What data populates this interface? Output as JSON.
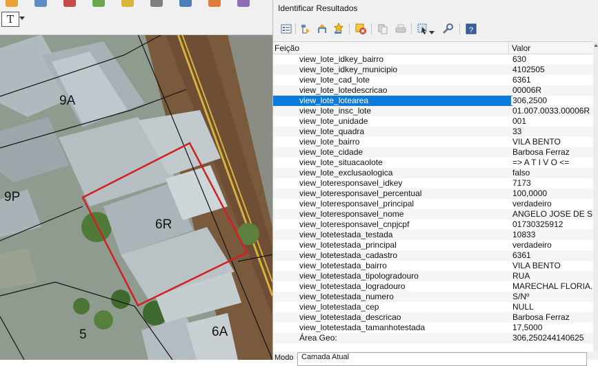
{
  "panel": {
    "title": "Identificar Resultados",
    "columns": {
      "feature": "Feição",
      "value": "Valor"
    },
    "rows": [
      {
        "key": "view_lote_idkey_bairro",
        "value": "630"
      },
      {
        "key": "view_lote_idkey_municipio",
        "value": "4102505"
      },
      {
        "key": "view_lote_cad_lote",
        "value": "6361"
      },
      {
        "key": "view_lote_lotedescricao",
        "value": "00006R"
      },
      {
        "key": "view_lote_lotearea",
        "value": "306,2500"
      },
      {
        "key": "view_lote_insc_lote",
        "value": "01.007.0033.00006R"
      },
      {
        "key": "view_lote_unidade",
        "value": "001"
      },
      {
        "key": "view_lote_quadra",
        "value": "33"
      },
      {
        "key": "view_lote_bairro",
        "value": "VILA BENTO"
      },
      {
        "key": "view_lote_cidade",
        "value": "Barbosa Ferraz"
      },
      {
        "key": "view_lote_situacaolote",
        "value": "=> A T I V O <="
      },
      {
        "key": "view_lote_exclusaologica",
        "value": "falso"
      },
      {
        "key": "view_loteresponsavel_idkey",
        "value": "7173"
      },
      {
        "key": "view_loteresponsavel_percentual",
        "value": "100,0000"
      },
      {
        "key": "view_loteresponsavel_principal",
        "value": "verdadeiro"
      },
      {
        "key": "view_loteresponsavel_nome",
        "value": "ANGELO JOSE DE S..."
      },
      {
        "key": "view_loteresponsavel_cnpjcpf",
        "value": "01730325912"
      },
      {
        "key": "view_lotetestada_testada",
        "value": "10833"
      },
      {
        "key": "view_lotetestada_principal",
        "value": "verdadeiro"
      },
      {
        "key": "view_lotetestada_cadastro",
        "value": "6361"
      },
      {
        "key": "view_lotetestada_bairro",
        "value": "VILA BENTO"
      },
      {
        "key": "view_lotetestada_tipologradouro",
        "value": "RUA"
      },
      {
        "key": "view_lotetestada_logradouro",
        "value": "MARECHAL FLORIA..."
      },
      {
        "key": "view_lotetestada_numero",
        "value": "S/Nº"
      },
      {
        "key": "view_lotetestada_cep",
        "value": "NULL"
      },
      {
        "key": "view_lotetestada_descricao",
        "value": "Barbosa Ferraz"
      },
      {
        "key": "view_lotetestada_tamanhotestada",
        "value": "17,5000"
      },
      {
        "key": "Área Geo:",
        "value": "306,250244140625"
      }
    ],
    "selected_row_index": 4,
    "mode_label": "Modo",
    "mode_value": "Camada Atual",
    "toolbar_icons": [
      "expand-tree-icon",
      "collapse-tree-icon",
      "expand-new-icon",
      "expand-all-icon",
      "clear-results-icon",
      "copy-feature-icon",
      "print-icon",
      "select-feature-icon",
      "identify-settings-icon",
      "help-icon"
    ]
  },
  "map": {
    "text_tool_glyph": "T",
    "lot_labels": [
      {
        "id": "9A",
        "text": "9A"
      },
      {
        "id": "9P",
        "text": "9P"
      },
      {
        "id": "6R",
        "text": "6R"
      },
      {
        "id": "5",
        "text": "5"
      },
      {
        "id": "6A",
        "text": "6A"
      }
    ],
    "highlight_color": "#d0201f"
  }
}
